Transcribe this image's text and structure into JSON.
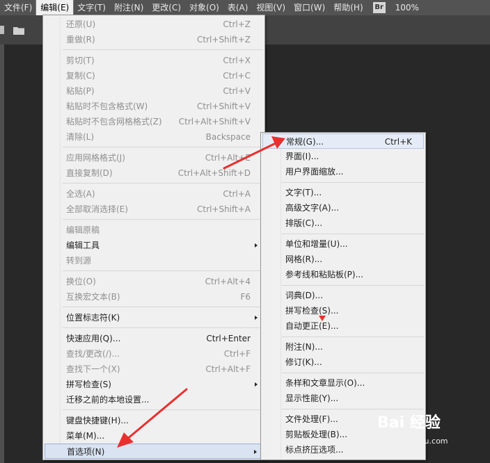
{
  "menubar": {
    "items": [
      "文件(F)",
      "编辑(E)",
      "文字(T)",
      "附注(N)",
      "更改(C)",
      "对象(O)",
      "表(A)",
      "视图(V)",
      "窗口(W)",
      "帮助(H)"
    ],
    "active_index": 1,
    "app_badge": "Br",
    "zoom": "100%"
  },
  "edit_menu": {
    "items": [
      {
        "label": "还原(U)",
        "shortcut": "Ctrl+Z",
        "enabled": false
      },
      {
        "label": "重做(R)",
        "shortcut": "Ctrl+Shift+Z",
        "enabled": false
      },
      {
        "label": "剪切(T)",
        "shortcut": "Ctrl+X",
        "enabled": false
      },
      {
        "label": "复制(C)",
        "shortcut": "Ctrl+C",
        "enabled": false
      },
      {
        "label": "粘贴(P)",
        "shortcut": "Ctrl+V",
        "enabled": false
      },
      {
        "label": "粘贴时不包含格式(W)",
        "shortcut": "Ctrl+Shift+V",
        "enabled": false
      },
      {
        "label": "粘贴时不包含网格格式(Z)",
        "shortcut": "Ctrl+Alt+Shift+V",
        "enabled": false
      },
      {
        "label": "清除(L)",
        "shortcut": "Backspace",
        "enabled": false
      },
      {
        "label": "应用网格格式(J)",
        "shortcut": "Ctrl+Alt+E",
        "enabled": false
      },
      {
        "label": "直接复制(D)",
        "shortcut": "Ctrl+Alt+Shift+D",
        "enabled": false
      },
      {
        "label": "全选(A)",
        "shortcut": "Ctrl+A",
        "enabled": false
      },
      {
        "label": "全部取消选择(E)",
        "shortcut": "Ctrl+Shift+A",
        "enabled": false
      },
      {
        "label": "编辑原稿",
        "shortcut": "",
        "enabled": false
      },
      {
        "label": "编辑工具",
        "shortcut": "",
        "enabled": true,
        "submenu": true
      },
      {
        "label": "转到源",
        "shortcut": "",
        "enabled": false
      },
      {
        "label": "换位(O)",
        "shortcut": "Ctrl+Alt+4",
        "enabled": false
      },
      {
        "label": "互换宏文本(B)",
        "shortcut": "F6",
        "enabled": false
      },
      {
        "label": "位置标志符(K)",
        "shortcut": "",
        "enabled": true,
        "submenu": true
      },
      {
        "label": "快速应用(Q)...",
        "shortcut": "Ctrl+Enter",
        "enabled": true
      },
      {
        "label": "查找/更改(/)...",
        "shortcut": "Ctrl+F",
        "enabled": false
      },
      {
        "label": "查找下一个(X)",
        "shortcut": "Ctrl+Alt+F",
        "enabled": false
      },
      {
        "label": "拼写检查(S)",
        "shortcut": "",
        "enabled": true,
        "submenu": true
      },
      {
        "label": "迁移之前的本地设置...",
        "shortcut": "",
        "enabled": true
      },
      {
        "label": "键盘快捷键(H)...",
        "shortcut": "",
        "enabled": true
      },
      {
        "label": "菜单(M)...",
        "shortcut": "",
        "enabled": true
      },
      {
        "label": "首选项(N)",
        "shortcut": "",
        "enabled": true,
        "submenu": true,
        "highlighted": true
      }
    ]
  },
  "preferences_submenu": {
    "items": [
      {
        "label": "常规(G)...",
        "shortcut": "Ctrl+K",
        "highlighted": true
      },
      {
        "label": "界面(I)...",
        "shortcut": ""
      },
      {
        "label": "用户界面缩放...",
        "shortcut": ""
      },
      {
        "label": "文字(T)...",
        "shortcut": ""
      },
      {
        "label": "高级文字(A)...",
        "shortcut": ""
      },
      {
        "label": "排版(C)...",
        "shortcut": ""
      },
      {
        "label": "单位和增量(U)...",
        "shortcut": ""
      },
      {
        "label": "网格(R)...",
        "shortcut": ""
      },
      {
        "label": "参考线和粘贴板(P)...",
        "shortcut": ""
      },
      {
        "label": "词典(D)...",
        "shortcut": ""
      },
      {
        "label": "拼写检查(S)...",
        "shortcut": ""
      },
      {
        "label": "自动更正(E)...",
        "shortcut": ""
      },
      {
        "label": "附注(N)...",
        "shortcut": ""
      },
      {
        "label": "修订(K)...",
        "shortcut": ""
      },
      {
        "label": "条样和文章显示(O)...",
        "shortcut": ""
      },
      {
        "label": "显示性能(Y)...",
        "shortcut": ""
      },
      {
        "label": "文件处理(F)...",
        "shortcut": ""
      },
      {
        "label": "剪贴板处理(B)...",
        "shortcut": ""
      },
      {
        "label": "标点挤压选项...",
        "shortcut": ""
      }
    ]
  },
  "annotation_color": "#e8302e",
  "watermark": {
    "logo": "Bai 经验",
    "site": "jingyan.baidu.com"
  }
}
